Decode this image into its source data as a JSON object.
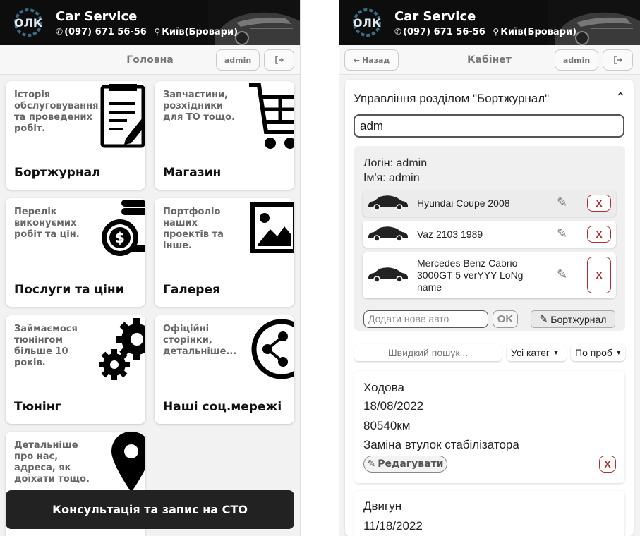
{
  "header": {
    "brand": "Car Service",
    "phone": "(097) 671 56-56",
    "location": "Київ(Бровари)",
    "logo_text": "ОЛК"
  },
  "left": {
    "nav": {
      "title": "Головна",
      "user_label": "admin"
    },
    "tiles": [
      {
        "desc": "Історія обслуговування та проведених робіт.",
        "title": "Бортжурнал",
        "icon": "journal-icon"
      },
      {
        "desc": "Запчастини, розхідники для ТО тощо.",
        "title": "Магазин",
        "icon": "cart-icon"
      },
      {
        "desc": "Перелік виконуємих робіт та цін.",
        "title": "Послуги та ціни",
        "icon": "coins-icon"
      },
      {
        "desc": "Портфоліо наших проектів та інше.",
        "title": "Галерея",
        "icon": "gallery-icon"
      },
      {
        "desc": "Займаємося тюнінгом більше 10 років.",
        "title": "Тюнінг",
        "icon": "gears-icon"
      },
      {
        "desc": "Офіційні сторінки, детальніше...",
        "title": "Наші соц.мережі",
        "icon": "share-icon"
      },
      {
        "desc": "Детальніше про нас, адреса, як доїхати тощо.",
        "title": "",
        "icon": "location-pin-icon"
      }
    ],
    "cta": "Консультація та запис на СТО"
  },
  "right": {
    "nav": {
      "back_label": "Назад",
      "title": "Кабінет",
      "user_label": "admin"
    },
    "section_title": "Управління розділом \"Бортжурнал\"",
    "search_value": "adm",
    "user": {
      "login": "Логін: admin",
      "name": "Ім'я: admin"
    },
    "cars": [
      {
        "name": "Hyundai Coupe 2008",
        "delete_label": "X"
      },
      {
        "name": "Vaz 2103 1989",
        "delete_label": "X"
      },
      {
        "name": "Mercedes Benz Cabrio 3000GT 5 verYYY LoNg name",
        "delete_label": "X"
      }
    ],
    "add_car_placeholder": "Додати нове авто",
    "ok_label": "OK",
    "journal_button": "Бортжурнал",
    "quick_search_placeholder": "Швидкий пошук...",
    "category_filter": "Усі катег",
    "sort_filter": "По проб",
    "entries": [
      {
        "category": "Ходова",
        "date": "18/08/2022",
        "mileage": "80540км",
        "work": "Заміна втулок стабілізатора",
        "edit_label": "Редагувати",
        "delete_label": "X"
      },
      {
        "category": "Двигун",
        "date": "11/18/2022"
      }
    ],
    "colors": {
      "delete_red": "#b42d2d",
      "header_bg": "#0d0d0d",
      "cta_bg": "#222222"
    }
  }
}
